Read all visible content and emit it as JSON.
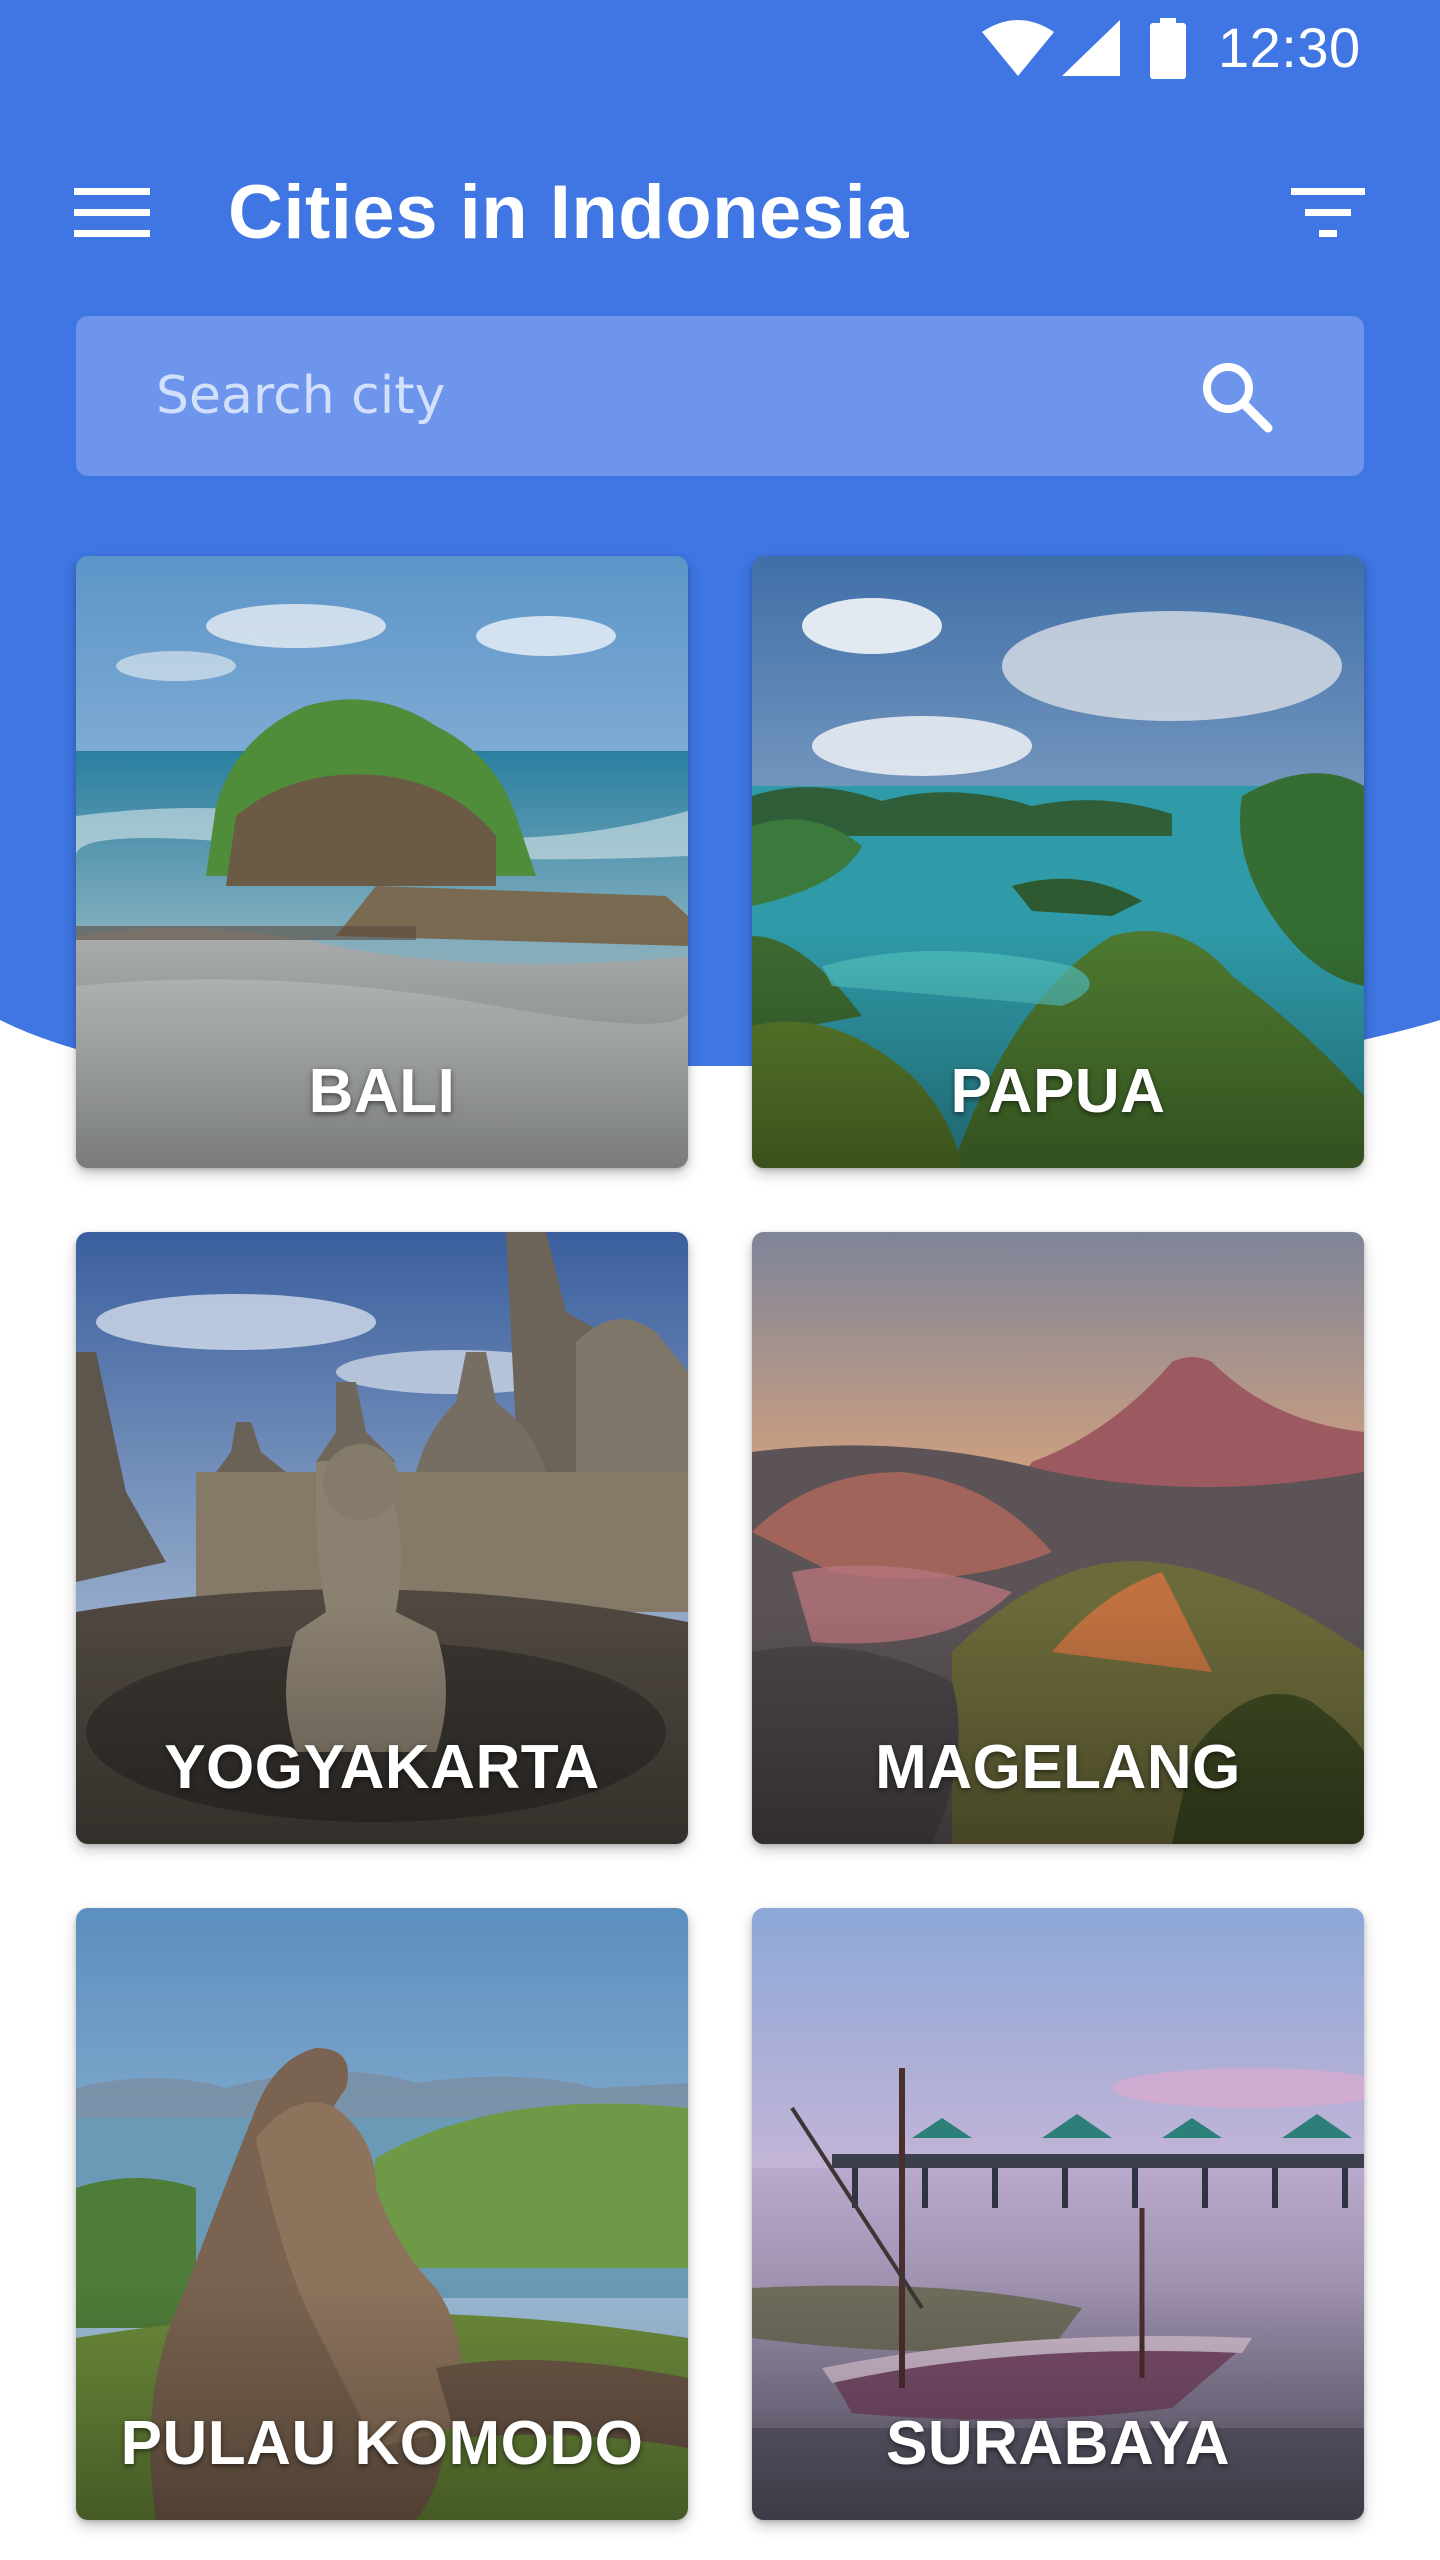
{
  "colors": {
    "primary": "#3f76e3",
    "search_background": "#6d95ec",
    "page_background": "#ffffff"
  },
  "status_bar": {
    "time": "12:30",
    "icons": [
      "wifi-icon",
      "signal-icon",
      "battery-icon"
    ]
  },
  "toolbar": {
    "menu_icon": "hamburger-menu-icon",
    "title": "Cities in Indonesia",
    "filter_icon": "filter-icon"
  },
  "search": {
    "placeholder": "Search city",
    "value": "",
    "icon": "search-icon"
  },
  "cities": [
    {
      "name": "BALI"
    },
    {
      "name": "PAPUA"
    },
    {
      "name": "YOGYAKARTA"
    },
    {
      "name": "MAGELANG"
    },
    {
      "name": "PULAU KOMODO"
    },
    {
      "name": "SURABAYA"
    }
  ]
}
